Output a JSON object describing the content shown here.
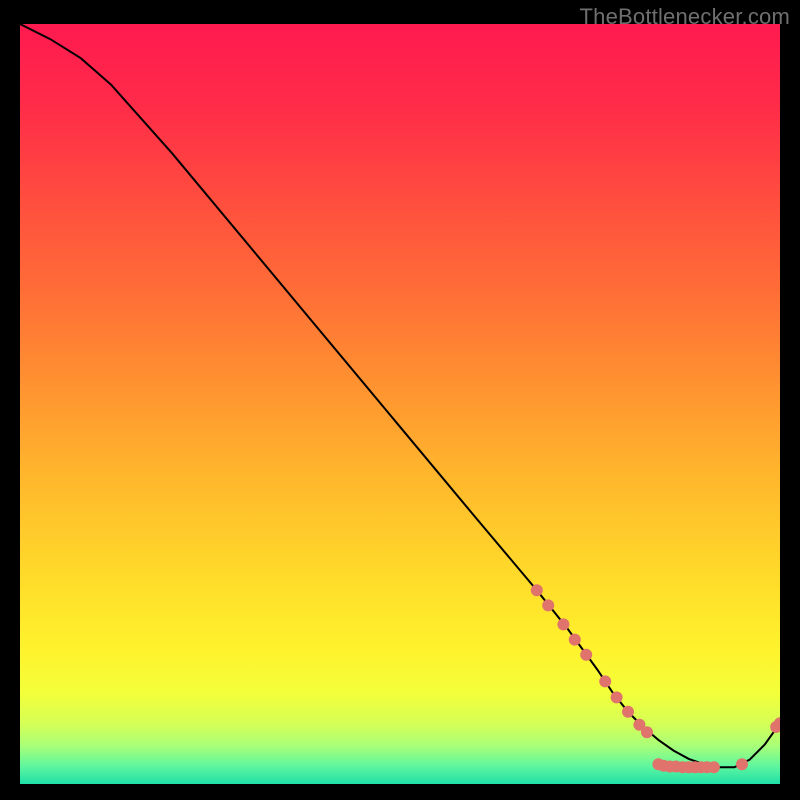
{
  "attribution": "TheBottlenecker.com",
  "chart_data": {
    "type": "line",
    "title": "",
    "xlabel": "",
    "ylabel": "",
    "xlim": [
      0,
      100
    ],
    "ylim": [
      0,
      100
    ],
    "grid": false,
    "series": [
      {
        "name": "curve",
        "x": [
          0,
          4,
          8,
          12,
          20,
          30,
          40,
          50,
          60,
          68,
          72,
          76,
          78,
          80,
          82,
          84,
          86,
          88,
          90,
          92,
          94,
          96,
          98,
          100
        ],
        "y": [
          100,
          98,
          95.5,
          92,
          83,
          71,
          59,
          47,
          35,
          25.5,
          20.5,
          15,
          12,
          9.5,
          7.5,
          5.8,
          4.4,
          3.3,
          2.6,
          2.2,
          2.2,
          3.2,
          5.2,
          8.0
        ]
      }
    ],
    "markers": [
      {
        "x": 68.0,
        "y": 25.5
      },
      {
        "x": 69.5,
        "y": 23.5
      },
      {
        "x": 71.5,
        "y": 21.0
      },
      {
        "x": 73.0,
        "y": 19.0
      },
      {
        "x": 74.5,
        "y": 17.0
      },
      {
        "x": 77.0,
        "y": 13.5
      },
      {
        "x": 78.5,
        "y": 11.4
      },
      {
        "x": 80.0,
        "y": 9.5
      },
      {
        "x": 81.5,
        "y": 7.8
      },
      {
        "x": 82.5,
        "y": 6.8
      },
      {
        "x": 84.0,
        "y": 2.6
      },
      {
        "x": 84.7,
        "y": 2.4
      },
      {
        "x": 85.5,
        "y": 2.3
      },
      {
        "x": 86.3,
        "y": 2.3
      },
      {
        "x": 87.2,
        "y": 2.2
      },
      {
        "x": 88.0,
        "y": 2.2
      },
      {
        "x": 88.8,
        "y": 2.2
      },
      {
        "x": 89.6,
        "y": 2.2
      },
      {
        "x": 90.4,
        "y": 2.2
      },
      {
        "x": 91.3,
        "y": 2.2
      },
      {
        "x": 95.0,
        "y": 2.6
      },
      {
        "x": 99.5,
        "y": 7.5
      },
      {
        "x": 100.0,
        "y": 8.0
      }
    ],
    "gradient_stops": [
      {
        "offset": 0.0,
        "color": "#ff1a50"
      },
      {
        "offset": 0.1,
        "color": "#ff2a49"
      },
      {
        "offset": 0.22,
        "color": "#ff4a3f"
      },
      {
        "offset": 0.35,
        "color": "#ff6d37"
      },
      {
        "offset": 0.48,
        "color": "#ff9430"
      },
      {
        "offset": 0.6,
        "color": "#ffb82c"
      },
      {
        "offset": 0.72,
        "color": "#ffd92a"
      },
      {
        "offset": 0.82,
        "color": "#fff22c"
      },
      {
        "offset": 0.88,
        "color": "#f3ff3a"
      },
      {
        "offset": 0.92,
        "color": "#d6ff55"
      },
      {
        "offset": 0.95,
        "color": "#a8ff78"
      },
      {
        "offset": 0.975,
        "color": "#63f79d"
      },
      {
        "offset": 1.0,
        "color": "#1fe0a8"
      }
    ],
    "marker_color": "#e0746c",
    "line_color": "#000000"
  }
}
